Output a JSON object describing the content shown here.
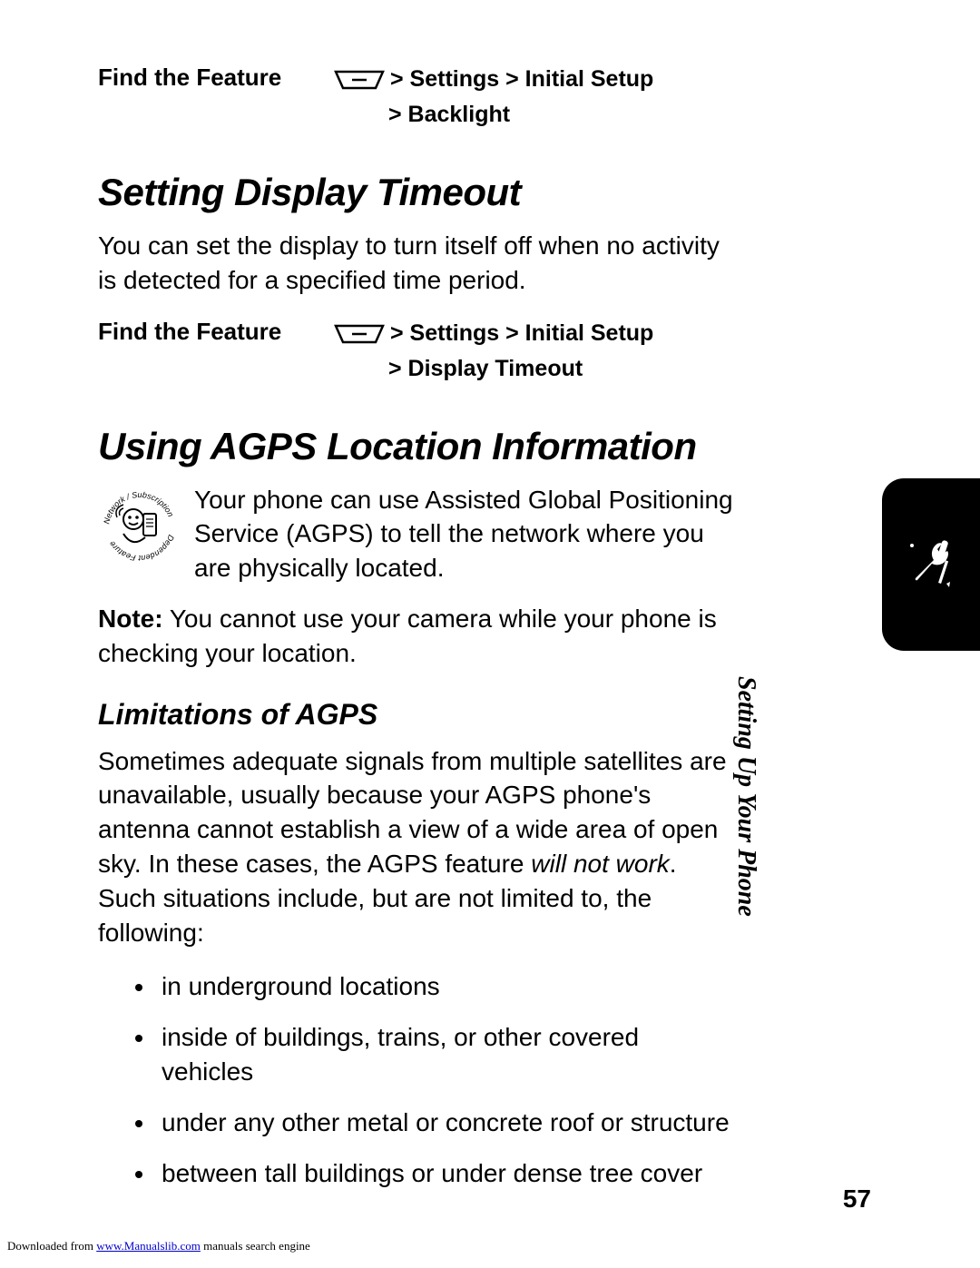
{
  "find_label": "Find the Feature",
  "path1": {
    "line1": "> Settings > Initial Setup",
    "line2": "> Backlight"
  },
  "heading1": "Setting Display Timeout",
  "body1": "You can set the display to turn itself off when no activity is detected for a specified time period.",
  "path2": {
    "line1": "> Settings > Initial Setup",
    "line2": "> Display Timeout"
  },
  "heading2": "Using AGPS Location Information",
  "agps_icon_label": "Network / Subscription Dependent Feature",
  "body2": "Your phone can use Assisted Global Positioning Service (AGPS) to tell the network where you are physically located.",
  "note_label": "Note:",
  "note_body": " You cannot use your camera while your phone is checking your location.",
  "subheading": "Limitations of AGPS",
  "body3a": "Sometimes adequate signals from multiple satellites are unavailable, usually because your AGPS phone's antenna cannot establish a view of a wide area of open sky. In these cases, the AGPS feature ",
  "body3_italic": "will not work",
  "body3b": ". Such situations include, but are not limited to, the following:",
  "bullets": [
    "in underground locations",
    "inside of buildings, trains, or other covered vehicles",
    "under any other metal or concrete roof or structure",
    "between tall buildings or under dense tree cover"
  ],
  "side_text": "Setting Up Your Phone",
  "page_number": "57",
  "download": {
    "pre": "Downloaded from ",
    "link": "www.Manualslib.com",
    "href": "http://www.Manualslib.com",
    "post": " manuals search engine"
  }
}
